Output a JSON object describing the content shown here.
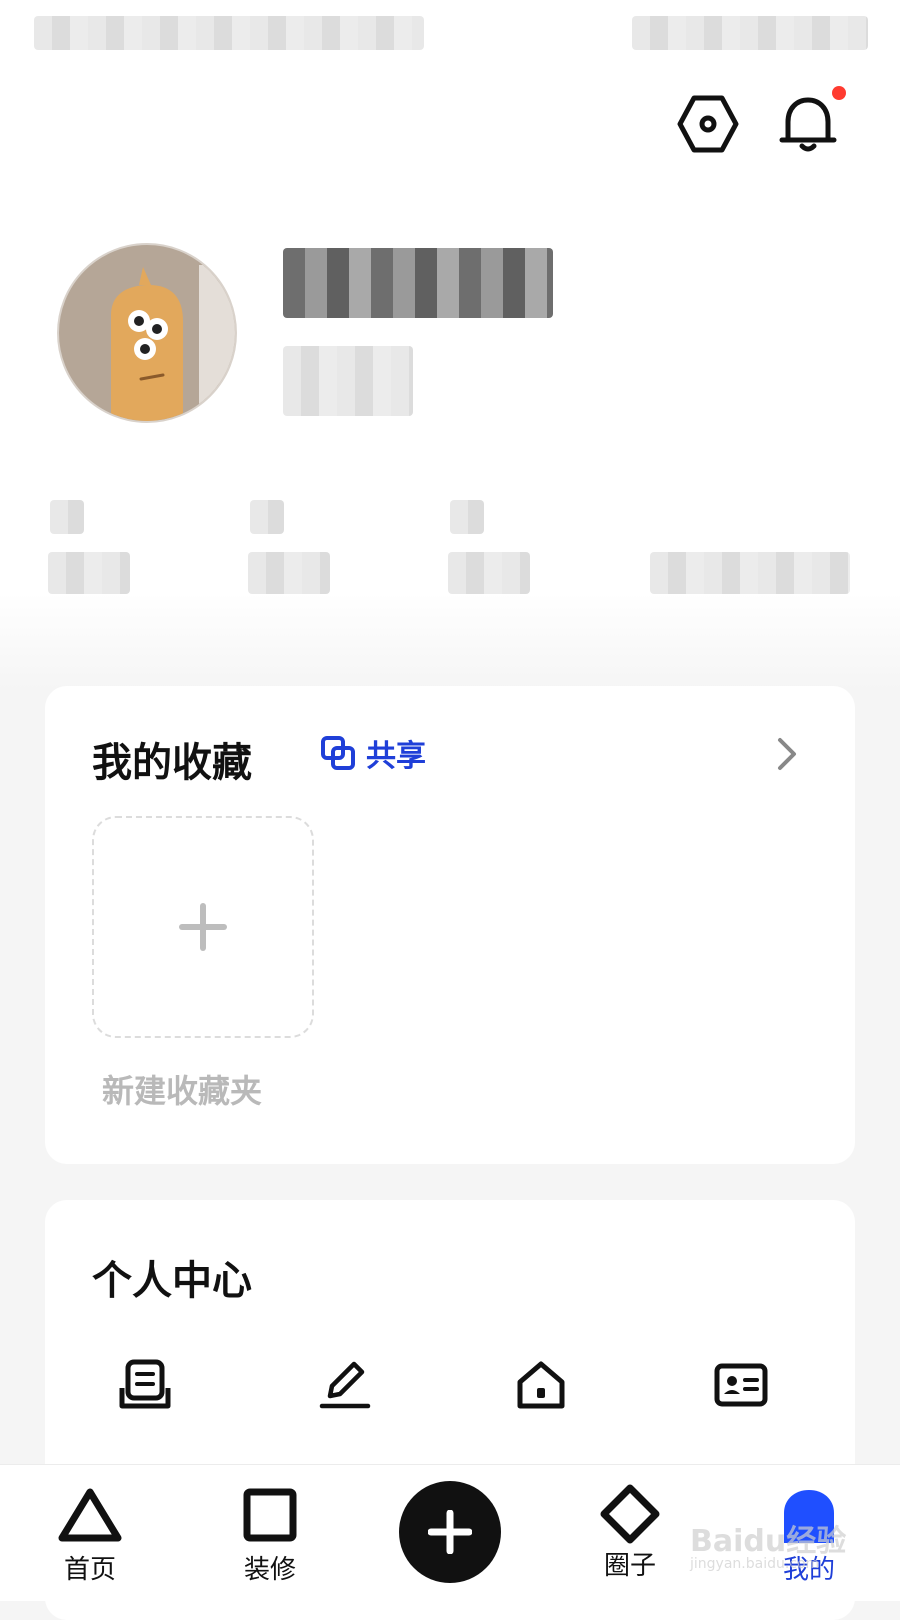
{
  "colors": {
    "accent": "#1f3fd8",
    "notification_dot": "#ff3b30",
    "background": "#f5f5f5",
    "card": "#ffffff"
  },
  "header": {
    "icons": [
      "settings-icon",
      "bell-icon"
    ],
    "has_notification": true
  },
  "favorites": {
    "title": "我的收藏",
    "share_label": "共享",
    "new_folder_label": "新建收藏夹"
  },
  "personal_center": {
    "title": "个人中心",
    "items": [
      {
        "icon": "drafts-icon"
      },
      {
        "icon": "edit-icon"
      },
      {
        "icon": "home-icon"
      },
      {
        "icon": "id-card-icon"
      }
    ]
  },
  "tabbar": {
    "tabs": [
      {
        "label": "首页",
        "icon": "triangle-icon"
      },
      {
        "label": "装修",
        "icon": "square-icon"
      },
      {
        "label": "",
        "icon": "plus-icon"
      },
      {
        "label": "圈子",
        "icon": "diamond-icon"
      },
      {
        "label": "我的",
        "icon": "profile-icon",
        "active": true
      }
    ]
  },
  "watermark": {
    "text": "Baidu经验",
    "sub": "jingyan.baidu.com"
  }
}
